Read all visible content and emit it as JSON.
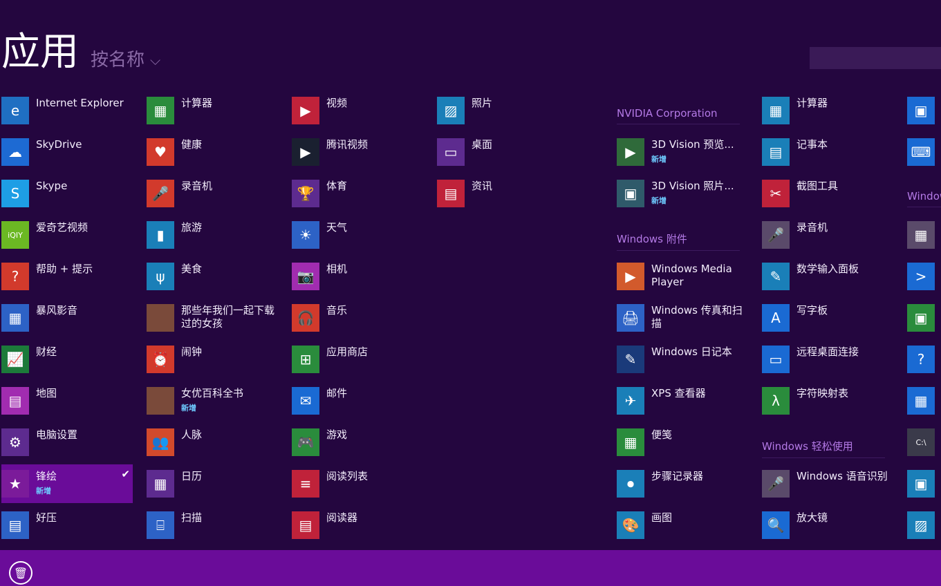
{
  "header": {
    "title": "应用",
    "sort_label": "按名称",
    "sort_chevron": "⌵"
  },
  "new_badge": "新增",
  "columns": [
    [
      {
        "label": "Internet Explorer",
        "icon": "internet-explorer-icon",
        "glyph": "e",
        "color": "#1f6fc2"
      },
      {
        "label": "SkyDrive",
        "icon": "skydrive-icon",
        "glyph": "☁",
        "color": "#1d6ad3"
      },
      {
        "label": "Skype",
        "icon": "skype-icon",
        "glyph": "S",
        "color": "#1e9ee5"
      },
      {
        "label": "爱奇艺视频",
        "icon": "iqiyi-icon",
        "glyph": "iQIY",
        "color": "#6bb823"
      },
      {
        "label": "帮助 + 提示",
        "icon": "help-icon",
        "glyph": "?",
        "color": "#d23a2c"
      },
      {
        "label": "暴风影音",
        "icon": "film-icon",
        "glyph": "▦",
        "color": "#2d62c6"
      },
      {
        "label": "财经",
        "icon": "finance-icon",
        "glyph": "📈",
        "color": "#1c7a3a"
      },
      {
        "label": "地图",
        "icon": "map-icon",
        "glyph": "▤",
        "color": "#a12cb0"
      },
      {
        "label": "电脑设置",
        "icon": "settings-icon",
        "glyph": "⚙",
        "color": "#5d2b8f"
      },
      {
        "label": "锋绘",
        "icon": "star-icon",
        "glyph": "★",
        "color": "#7b1b9a",
        "badge": true,
        "selected": true
      },
      {
        "label": "好压",
        "icon": "archive-icon",
        "glyph": "▤",
        "color": "#2d62c6"
      }
    ],
    [
      {
        "label": "计算器",
        "icon": "calculator-icon",
        "glyph": "▦",
        "color": "#2a8c3c"
      },
      {
        "label": "健康",
        "icon": "health-icon",
        "glyph": "♥",
        "color": "#d23a2c"
      },
      {
        "label": "录音机",
        "icon": "microphone-icon",
        "glyph": "🎤",
        "color": "#d23a2c"
      },
      {
        "label": "旅游",
        "icon": "travel-icon",
        "glyph": "▮",
        "color": "#1a7fb8"
      },
      {
        "label": "美食",
        "icon": "food-icon",
        "glyph": "ψ",
        "color": "#1a7fb8"
      },
      {
        "label": "那些年我们一起下载过的女孩",
        "icon": "photo-thumbnail-icon",
        "glyph": "",
        "color": "#7a4a3a"
      },
      {
        "label": "闹钟",
        "icon": "alarm-icon",
        "glyph": "⏰",
        "color": "#d23a2c"
      },
      {
        "label": "女优百科全书",
        "icon": "photo-thumbnail-icon",
        "glyph": "",
        "color": "#7a4a3a",
        "badge": true
      },
      {
        "label": "人脉",
        "icon": "people-icon",
        "glyph": "👥",
        "color": "#d24a2c"
      },
      {
        "label": "日历",
        "icon": "calendar-icon",
        "glyph": "▦",
        "color": "#5d2b8f"
      },
      {
        "label": "扫描",
        "icon": "scan-icon",
        "glyph": "⌸",
        "color": "#2d62c6"
      }
    ],
    [
      {
        "label": "视频",
        "icon": "video-icon",
        "glyph": "▶",
        "color": "#c0223a"
      },
      {
        "label": "腾讯视频",
        "icon": "tencent-video-icon",
        "glyph": "▶",
        "color": "#1a2030"
      },
      {
        "label": "体育",
        "icon": "trophy-icon",
        "glyph": "🏆",
        "color": "#5d2b8f"
      },
      {
        "label": "天气",
        "icon": "weather-icon",
        "glyph": "☀",
        "color": "#2d62c6"
      },
      {
        "label": "相机",
        "icon": "camera-icon",
        "glyph": "📷",
        "color": "#a12cb0"
      },
      {
        "label": "音乐",
        "icon": "headphones-icon",
        "glyph": "🎧",
        "color": "#d23a2c"
      },
      {
        "label": "应用商店",
        "icon": "store-icon",
        "glyph": "⊞",
        "color": "#2a8c3c"
      },
      {
        "label": "邮件",
        "icon": "mail-icon",
        "glyph": "✉",
        "color": "#1a6ad3"
      },
      {
        "label": "游戏",
        "icon": "gamepad-icon",
        "glyph": "🎮",
        "color": "#2a8c3c"
      },
      {
        "label": "阅读列表",
        "icon": "reading-list-icon",
        "glyph": "≡",
        "color": "#c0223a"
      },
      {
        "label": "阅读器",
        "icon": "reader-icon",
        "glyph": "▤",
        "color": "#c0223a"
      }
    ],
    [
      {
        "label": "照片",
        "icon": "photos-icon",
        "glyph": "▨",
        "color": "#1a7fb8"
      },
      {
        "label": "桌面",
        "icon": "desktop-icon",
        "glyph": "▭",
        "color": "#5d2b8f"
      },
      {
        "label": "资讯",
        "icon": "news-icon",
        "glyph": "▤",
        "color": "#c0223a"
      }
    ]
  ],
  "groups": [
    {
      "title": "NVIDIA Corporation",
      "items": [
        {
          "label": "3D Vision 预览...",
          "icon": "3d-vision-icon",
          "glyph": "▶",
          "color": "#2f6a3a",
          "badge": true
        },
        {
          "label": "3D Vision 照片...",
          "icon": "3d-vision-photo-icon",
          "glyph": "▣",
          "color": "#2f5a6a",
          "badge": true
        }
      ]
    },
    {
      "title": "Windows 附件",
      "items": [
        {
          "label": "Windows Media Player",
          "icon": "media-player-icon",
          "glyph": "▶",
          "color": "#d25a2c"
        },
        {
          "label": "Windows 传真和扫描",
          "icon": "fax-icon",
          "glyph": "🖨",
          "color": "#2d62c6"
        },
        {
          "label": "Windows 日记本",
          "icon": "journal-icon",
          "glyph": "✎",
          "color": "#1a3a7a"
        },
        {
          "label": "XPS 查看器",
          "icon": "xps-icon",
          "glyph": "✈",
          "color": "#1a7fb8"
        },
        {
          "label": "便笺",
          "icon": "sticky-notes-icon",
          "glyph": "▦",
          "color": "#2a8c3c"
        },
        {
          "label": "步骤记录器",
          "icon": "steps-recorder-icon",
          "glyph": "⏺",
          "color": "#1a7fb8"
        },
        {
          "label": "画图",
          "icon": "paint-icon",
          "glyph": "🎨",
          "color": "#1a7fb8"
        }
      ]
    },
    {
      "title": "",
      "items": [
        {
          "label": "计算器",
          "icon": "calculator-icon",
          "glyph": "▦",
          "color": "#1a7fb8"
        },
        {
          "label": "记事本",
          "icon": "notepad-icon",
          "glyph": "▤",
          "color": "#1a7fb8"
        },
        {
          "label": "截图工具",
          "icon": "snipping-tool-icon",
          "glyph": "✂",
          "color": "#c0223a"
        },
        {
          "label": "录音机",
          "icon": "microphone-icon",
          "glyph": "🎤",
          "color": "#5a4a6a"
        },
        {
          "label": "数学输入面板",
          "icon": "math-input-icon",
          "glyph": "✎",
          "color": "#1a7fb8"
        },
        {
          "label": "写字板",
          "icon": "wordpad-icon",
          "glyph": "A",
          "color": "#1a6ad3"
        },
        {
          "label": "远程桌面连接",
          "icon": "remote-desktop-icon",
          "glyph": "▭",
          "color": "#1a6ad3"
        },
        {
          "label": "字符映射表",
          "icon": "charmap-icon",
          "glyph": "λ",
          "color": "#2a8c3c"
        }
      ]
    },
    {
      "title": "Windows 轻松使用",
      "items": [
        {
          "label": "Windows 语音识别",
          "icon": "speech-recognition-icon",
          "glyph": "🎤",
          "color": "#5a4a6a"
        },
        {
          "label": "放大镜",
          "icon": "magnifier-icon",
          "glyph": "🔍",
          "color": "#1a6ad3"
        }
      ]
    },
    {
      "title": "Window",
      "items": []
    }
  ],
  "partial_icons": [
    {
      "icon": "network-icon",
      "glyph": "▣",
      "color": "#1a6ad3"
    },
    {
      "icon": "keyboard-icon",
      "glyph": "⌨",
      "color": "#1a6ad3"
    },
    {
      "icon": "firewall-icon",
      "glyph": "▦",
      "color": "#5a4a6a"
    },
    {
      "icon": "powershell-icon",
      "glyph": ">",
      "color": "#1a6ad3"
    },
    {
      "icon": "network-share-icon",
      "glyph": "▣",
      "color": "#2a8c3c"
    },
    {
      "icon": "help-icon",
      "glyph": "?",
      "color": "#1a6ad3"
    },
    {
      "icon": "control-panel-icon",
      "glyph": "▦",
      "color": "#1a6ad3"
    },
    {
      "icon": "command-prompt-icon",
      "glyph": "C:\\",
      "color": "#3a3a4a"
    },
    {
      "icon": "system-icon",
      "glyph": "▣",
      "color": "#1a7fb8"
    },
    {
      "icon": "performance-icon",
      "glyph": "▨",
      "color": "#1a7fb8"
    }
  ],
  "appbar": {
    "trash_glyph": "🗑"
  }
}
